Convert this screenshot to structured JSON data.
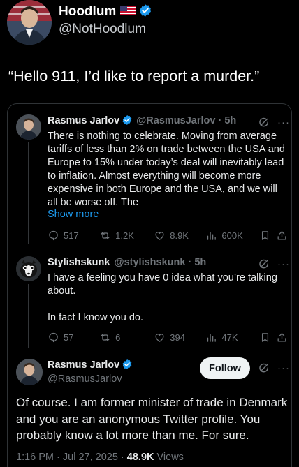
{
  "outer_post": {
    "author_name": "Hoodlum",
    "author_handle": "@NotHoodlum",
    "text": "“Hello 911, I’d like to report a murder.”"
  },
  "thread": {
    "tweets": [
      {
        "name": "Rasmus Jarlov",
        "handle": "@RasmusJarlov",
        "time": "5h",
        "text": "There is nothing to celebrate. Moving from average tariffs of less than 2% on trade between the USA and Europe to 15% under today’s deal will inevitably lead to inflation. Almost everything will become more expensive in both Europe and the USA, and we will all be worse off. The",
        "show_more": "Show more",
        "replies": "517",
        "reposts": "1.2K",
        "likes": "8.9K",
        "views": "600K"
      },
      {
        "name": "Stylishskunk",
        "handle": "@stylishskunk",
        "time": "5h",
        "text_line1": "I have a feeling you have 0 idea what you’re talking about.",
        "text_line2": "In fact I know you do.",
        "replies": "57",
        "reposts": "6",
        "likes": "394",
        "views": "47K"
      }
    ],
    "focus_tweet": {
      "name": "Rasmus Jarlov",
      "handle": "@RasmusJarlov",
      "follow_label": "Follow",
      "text": "Of course. I am former minister of trade in Denmark and you are an anonymous Twitter profile. You probably know a lot more than me. For sure.",
      "time": "1:16 PM · Jul 27, 2025 · ",
      "views_count": "48.9K",
      "views_label": " Views"
    }
  },
  "colors": {
    "background": "#000000",
    "text": "#e7e9ea",
    "muted": "#71767b",
    "accent": "#1d9bf0",
    "verified": "#1d9bf0"
  },
  "icons": [
    "verified-badge-icon",
    "us-flag-icon",
    "grok-icon",
    "more-icon",
    "reply-icon",
    "repost-icon",
    "like-icon",
    "views-icon",
    "bookmark-icon",
    "share-icon"
  ]
}
